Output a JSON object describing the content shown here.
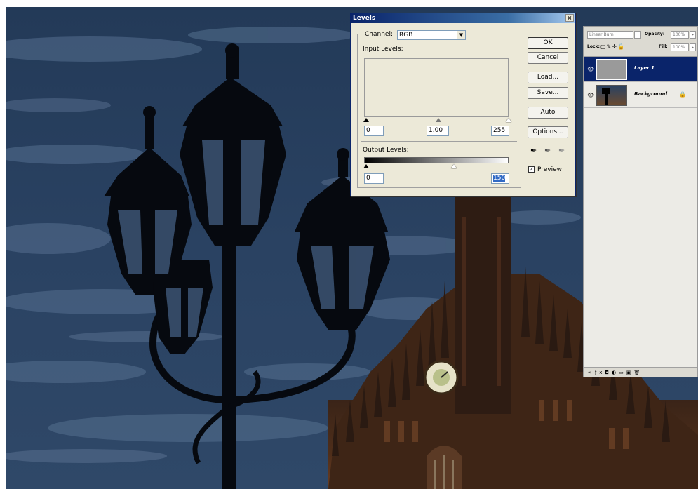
{
  "levels_dialog": {
    "title": "Levels",
    "close_glyph": "×",
    "channel_label": "Channel:",
    "channel_value": "RGB",
    "input_levels_label": "Input Levels:",
    "input_black": "0",
    "input_gamma": "1.00",
    "input_white": "255",
    "output_levels_label": "Output Levels:",
    "output_black": "0",
    "output_white": "150",
    "buttons": {
      "ok": "OK",
      "cancel": "Cancel",
      "load": "Load...",
      "save": "Save...",
      "auto": "Auto",
      "options": "Options..."
    },
    "preview_label": "Preview",
    "preview_checked": true
  },
  "layers_panel": {
    "blend_mode": "Linear Burn",
    "opacity_label": "Opacity:",
    "opacity_value": "100%",
    "lock_label": "Lock:",
    "fill_label": "Fill:",
    "fill_value": "100%",
    "layers": [
      {
        "name": "Layer 1",
        "active": true
      },
      {
        "name": "Background",
        "active": false
      }
    ],
    "bottom_icons": [
      "link-icon",
      "fx-icon",
      "mask-icon",
      "adjustment-icon",
      "folder-icon",
      "new-layer-icon",
      "trash-icon"
    ]
  },
  "colors": {
    "sky": "#1e3552",
    "cloud": "#5a7392",
    "dialog_bg": "#ece9d8",
    "title_blue": "#0a246a",
    "highlight": "#316ac5"
  }
}
